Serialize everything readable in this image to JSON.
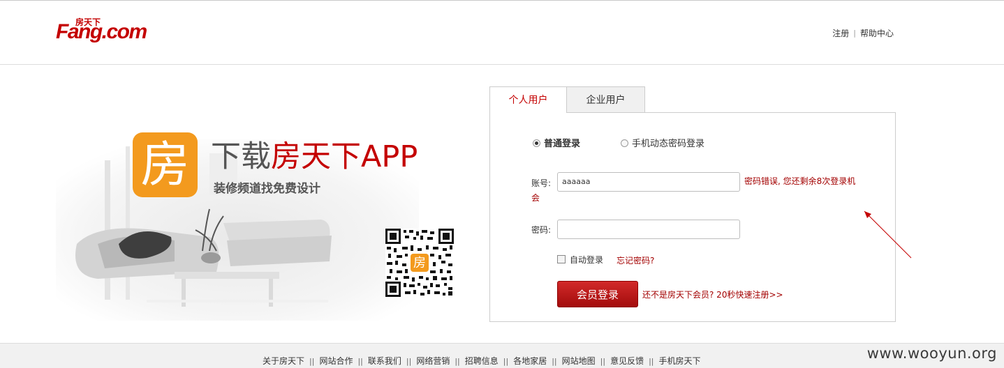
{
  "header": {
    "logo_cn": "房天下",
    "logo_en": "Fang.com",
    "links": [
      "注册",
      "帮助中心"
    ]
  },
  "promo": {
    "app_icon_char": "房",
    "title_prefix": "下载",
    "title_highlight": "房天下APP",
    "subtitle": "装修频道找免费设计",
    "qr_center_char": "房"
  },
  "login": {
    "tabs": [
      {
        "label": "个人用户",
        "active": true
      },
      {
        "label": "企业用户",
        "active": false
      }
    ],
    "modes": [
      {
        "label": "普通登录",
        "selected": true
      },
      {
        "label": "手机动态密码登录",
        "selected": false
      }
    ],
    "account_label": "账号:",
    "account_value": "aaaaaa",
    "error_message": "密码错误, 您还剩余8次登录机会",
    "password_label": "密码:",
    "password_value": "",
    "auto_login_label": "自动登录",
    "auto_login_checked": false,
    "forgot_label": "忘记密码?",
    "submit_label": "会员登录",
    "register_prompt": "还不是房天下会员? 20秒快速注册>>"
  },
  "footer": {
    "links": [
      "关于房天下",
      "网站合作",
      "联系我们",
      "网络营销",
      "招聘信息",
      "各地家居",
      "网站地图",
      "意见反馈",
      "手机房天下"
    ]
  },
  "watermark": "www.wooyun.org",
  "colors": {
    "brand_red": "#c40000",
    "app_orange": "#f39a1e",
    "error_red": "#a30000"
  }
}
